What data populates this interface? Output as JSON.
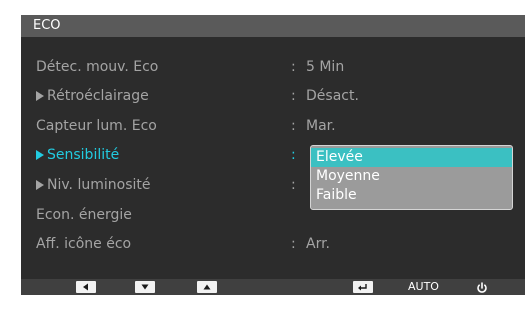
{
  "menu": {
    "title": "ECO",
    "rows": [
      {
        "label": "Détec. mouv. Eco",
        "colon": ":",
        "value": "5 Min"
      },
      {
        "label": "Rétroéclairage",
        "colon": ":",
        "value": "Désact."
      },
      {
        "label": "Capteur lum. Eco",
        "colon": ":",
        "value": "Mar."
      },
      {
        "label": "Sensibilité",
        "colon": ":",
        "value": ""
      },
      {
        "label": "Niv. luminosité",
        "colon": ":",
        "value": ""
      },
      {
        "label": "Econ. énergie",
        "colon": "",
        "value": ""
      },
      {
        "label": "Aff. icône éco",
        "colon": ":",
        "value": "Arr."
      }
    ]
  },
  "dropdown": {
    "options": [
      "Elevée",
      "Moyenne",
      "Faible"
    ],
    "selected": "Elevée"
  },
  "bottom_bar": {
    "auto_label": "AUTO",
    "icons": [
      "left-arrow-key-icon",
      "down-arrow-key-icon",
      "up-arrow-key-icon",
      "enter-key-icon",
      "power-icon"
    ]
  },
  "colors": {
    "background": "#2c2c2c",
    "title_bar": "#5a5a5a",
    "text": "#a4a4a4",
    "active": "#22cbe0",
    "dropdown_bg": "#9b9b9b",
    "dropdown_selected": "#3bc0c2",
    "bottom_bar": "#404040"
  }
}
